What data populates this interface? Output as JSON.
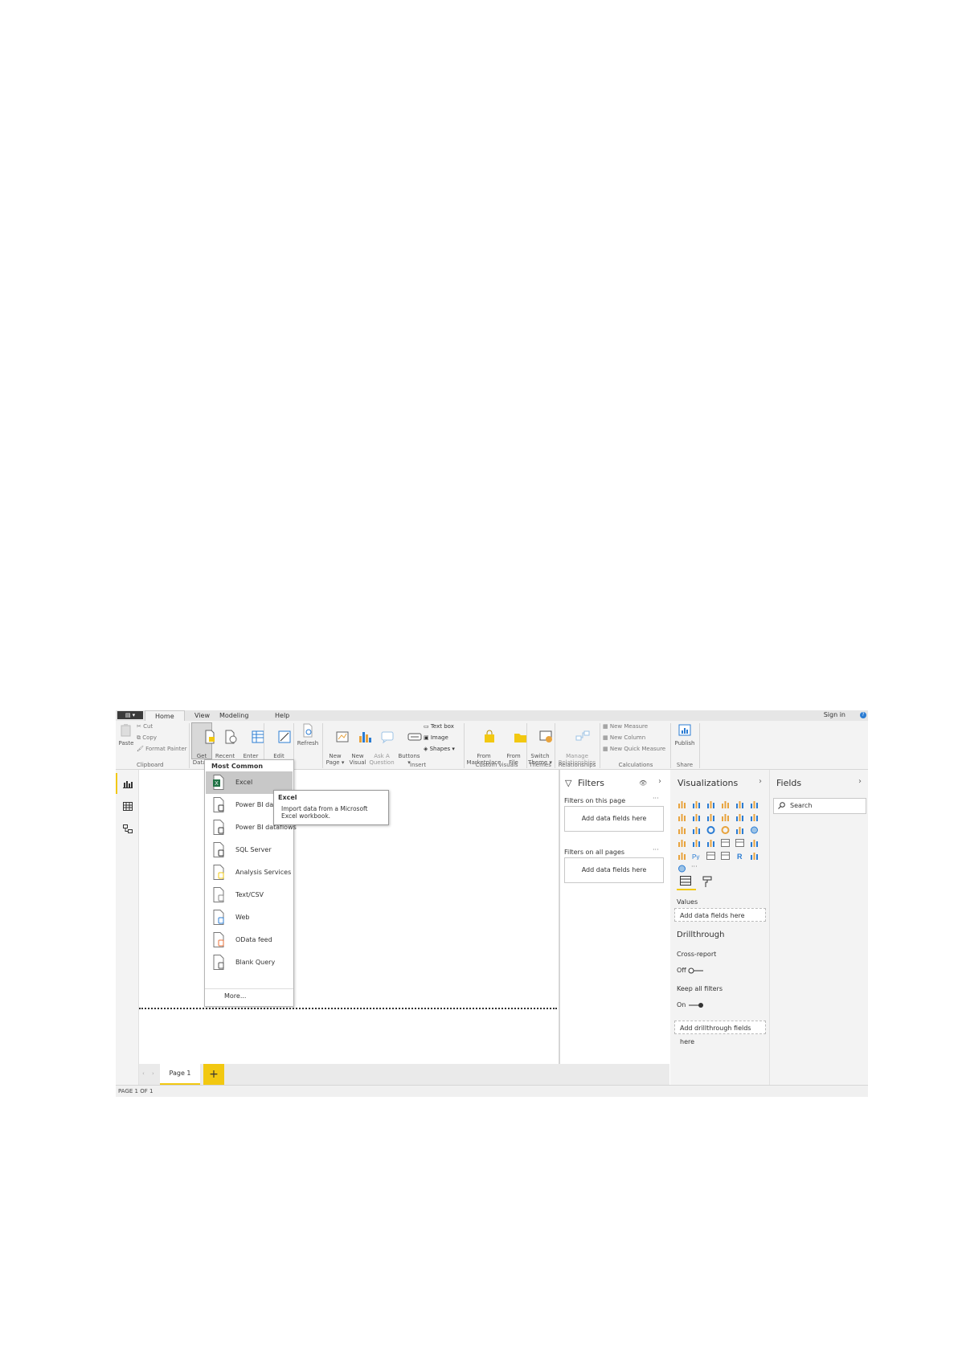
{
  "tabs": {
    "file": "▤ ▾",
    "home": "Home",
    "view": "View",
    "modeling": "Modeling",
    "help": "Help",
    "signin": "Sign in",
    "help_icon": "?"
  },
  "ribbon": {
    "paste": "Paste",
    "cut": "Cut",
    "copy": "Copy",
    "format_painter": "Format Painter",
    "get_data": "Get\nData ▾",
    "recent_sources": "Recent\nSources ▾",
    "enter_data": "Enter\nData",
    "edit_queries": "Edit\nQueries ▾",
    "refresh": "Refresh",
    "new_page": "New\nPage ▾",
    "new_visual": "New\nVisual",
    "ask_question": "Ask A\nQuestion",
    "buttons": "Buttons\n▾",
    "text_box": "Text box",
    "image": "Image",
    "shapes": "Shapes ▾",
    "from_marketplace": "From\nMarketplace",
    "from_file": "From\nFile",
    "switch_theme": "Switch\nTheme ▾",
    "manage_relationships": "Manage\nRelationships",
    "new_measure": "New Measure",
    "new_column": "New Column",
    "new_quick_measure": "New Quick Measure",
    "publish": "Publish",
    "groups": {
      "clipboard": "Clipboard",
      "insert": "Insert",
      "custom_visuals": "Custom visuals",
      "themes": "Themes",
      "relationships": "Relationships",
      "calculations": "Calculations",
      "share": "Share"
    }
  },
  "dropdown": {
    "header": "Most Common",
    "items": [
      {
        "label": "Excel",
        "icon": "excel-icon"
      },
      {
        "label": "Power BI datasets",
        "icon": "database-icon"
      },
      {
        "label": "Power BI dataflows",
        "icon": "dataflow-icon"
      },
      {
        "label": "SQL Server",
        "icon": "sql-server-icon"
      },
      {
        "label": "Analysis Services",
        "icon": "cube-icon"
      },
      {
        "label": "Text/CSV",
        "icon": "text-file-icon"
      },
      {
        "label": "Web",
        "icon": "globe-icon"
      },
      {
        "label": "OData feed",
        "icon": "odata-icon"
      },
      {
        "label": "Blank Query",
        "icon": "blank-query-icon"
      }
    ],
    "more": "More..."
  },
  "tooltip": {
    "title": "Excel",
    "description": "Import data from a Microsoft Excel workbook."
  },
  "filters": {
    "title": "Filters",
    "on_this_page": "Filters on this page",
    "on_all_pages": "Filters on all pages",
    "add_fields": "Add data fields here",
    "more": "···"
  },
  "visualizations": {
    "title": "Visualizations",
    "more": "···",
    "values": "Values",
    "add_fields": "Add data fields here",
    "drillthrough": "Drillthrough",
    "cross_report": "Cross-report",
    "cross_report_state": "Off",
    "keep_all_filters": "Keep all filters",
    "keep_all_filters_state": "On",
    "add_drillthrough": "Add drillthrough fields here"
  },
  "fields": {
    "title": "Fields",
    "search_placeholder": "Search"
  },
  "pages": {
    "page1": "Page 1",
    "add": "+"
  },
  "status": "PAGE 1 OF 1",
  "colors": {
    "accent": "#f2c811",
    "excel_green": "#217346",
    "blue": "#2b7cd3",
    "ribbon_bg": "#f3f3f3"
  }
}
